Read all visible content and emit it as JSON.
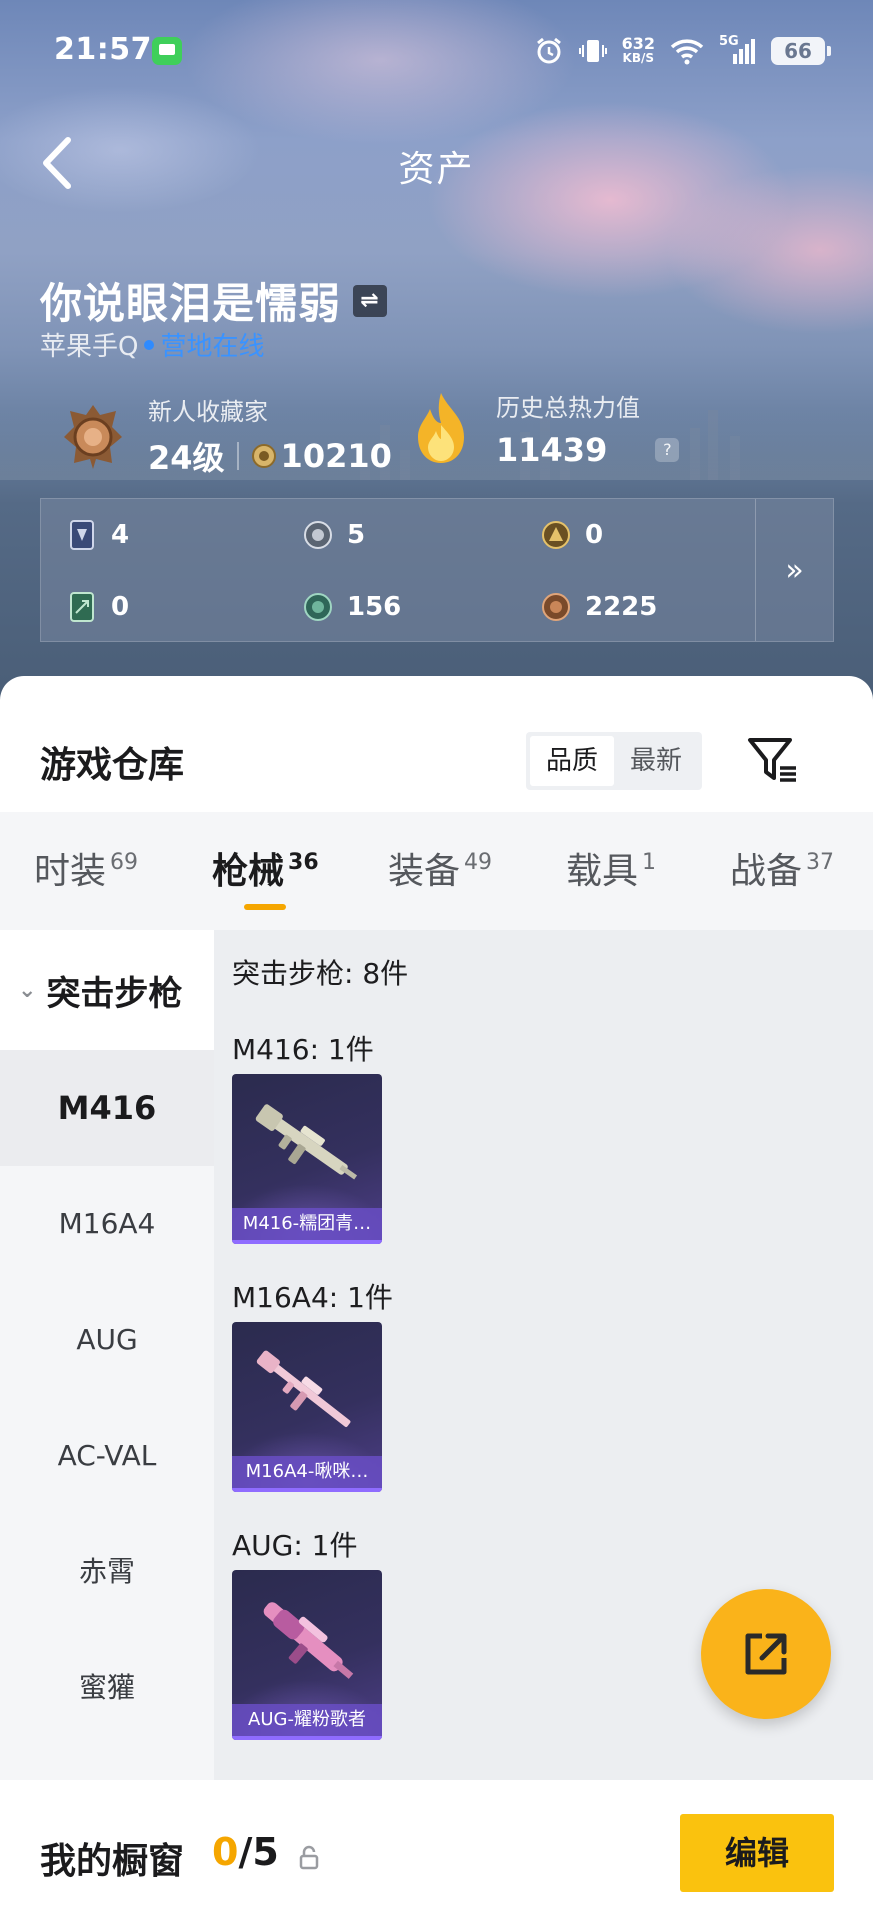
{
  "status_bar": {
    "time": "21:57",
    "net_speed": "632",
    "net_unit": "KB/S",
    "network": "5G",
    "battery": "66"
  },
  "header": {
    "title": "资产"
  },
  "profile": {
    "nickname": "你说眼泪是懦弱",
    "swap_icon": "swap-icon",
    "platform": "苹果手Q",
    "online_status": "营地在线",
    "rank_title": "新人收藏家",
    "rank_level": "24级",
    "rank_points": "10210",
    "heat_title": "历史总热力值",
    "heat_value": "11439",
    "help_glyph": "?"
  },
  "currencies": [
    {
      "icon": "card-icon",
      "value": "4"
    },
    {
      "icon": "silver-coin-icon",
      "value": "5"
    },
    {
      "icon": "gold-emblem-icon",
      "value": "0"
    },
    {
      "icon": "green-card-icon",
      "value": "0"
    },
    {
      "icon": "jade-coin-icon",
      "value": "156"
    },
    {
      "icon": "bronze-coin-icon",
      "value": "2225"
    }
  ],
  "more_glyph": "»",
  "warehouse": {
    "title": "游戏仓库",
    "sort_options": [
      "品质",
      "最新"
    ],
    "selected_sort": "品质",
    "tabs": [
      {
        "label": "时装",
        "count": "69"
      },
      {
        "label": "枪械",
        "count": "36"
      },
      {
        "label": "装备",
        "count": "49"
      },
      {
        "label": "载具",
        "count": "1"
      },
      {
        "label": "战备",
        "count": "37"
      }
    ],
    "active_tab": "枪械",
    "category": "突击步枪",
    "sidebar_items": [
      "M416",
      "M16A4",
      "AUG",
      "AC-VAL",
      "赤霄",
      "蜜獾"
    ],
    "active_item": "M416",
    "summary": "突击步枪: 8件",
    "groups": [
      {
        "heading": "M416: 1件",
        "item_label": "M416-糯团青…"
      },
      {
        "heading": "M16A4: 1件",
        "item_label": "M16A4-啾咪…"
      },
      {
        "heading": "AUG: 1件",
        "item_label": "AUG-耀粉歌者"
      }
    ]
  },
  "showcase": {
    "title": "我的橱窗",
    "current": "0",
    "separator": "/",
    "max": "5",
    "edit_label": "编辑"
  },
  "colors": {
    "accent": "#f5a600",
    "button_yellow": "#fac20e",
    "online_blue": "#3a93ff",
    "rarity_purple": "#6a4fc4"
  }
}
